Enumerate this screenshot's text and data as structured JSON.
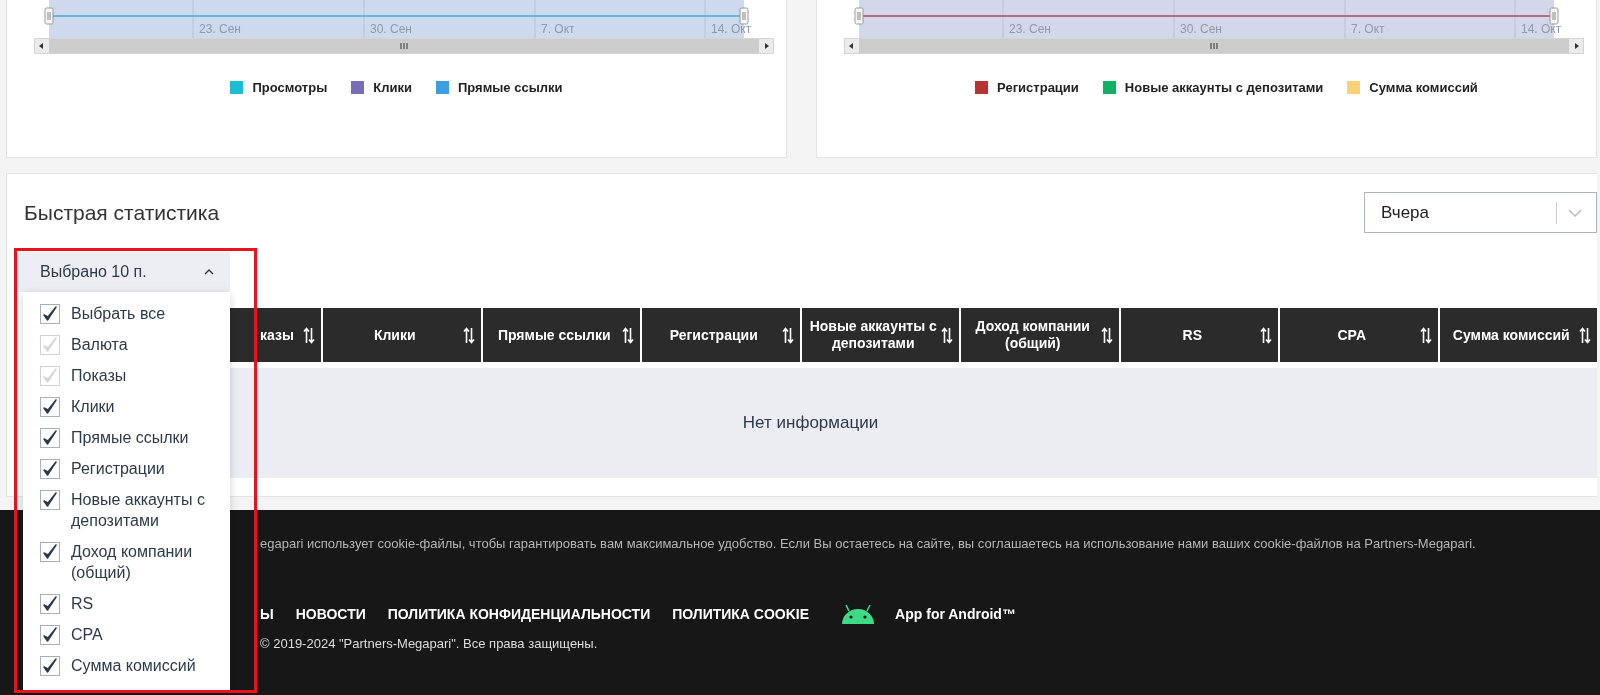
{
  "charts": [
    {
      "axis_labels": [
        "23. Сен",
        "30. Сен",
        "7. Окт",
        "14. Окт"
      ],
      "legend": [
        {
          "label": "Просмотры",
          "color": "#1bbcd4"
        },
        {
          "label": "Клики",
          "color": "#786cb4"
        },
        {
          "label": "Прямые ссылки",
          "color": "#3e9fe0"
        }
      ]
    },
    {
      "axis_labels": [
        "23. Сен",
        "30. Сен",
        "7. Окт",
        "14. Окт"
      ],
      "legend": [
        {
          "label": "Регистрации",
          "color": "#b83234"
        },
        {
          "label": "Новые аккаунты с депозитами",
          "color": "#12b062"
        },
        {
          "label": "Сумма комиссий",
          "color": "#fbd077"
        }
      ]
    }
  ],
  "quick_stats": {
    "title": "Быстрая статистика",
    "period_select": {
      "value": "Вчера"
    },
    "column_picker": {
      "label": "Выбрано 10 п.",
      "expanded": true,
      "options": [
        {
          "label": "Выбрать все",
          "checked": true,
          "disabled": false
        },
        {
          "label": "Валюта",
          "checked": true,
          "disabled": true
        },
        {
          "label": "Показы",
          "checked": true,
          "disabled": true
        },
        {
          "label": "Клики",
          "checked": true,
          "disabled": false
        },
        {
          "label": "Прямые ссылки",
          "checked": true,
          "disabled": false
        },
        {
          "label": "Регистрации",
          "checked": true,
          "disabled": false
        },
        {
          "label": "Новые аккаунты с депозитами",
          "checked": true,
          "disabled": false
        },
        {
          "label": "Доход компании (общий)",
          "checked": true,
          "disabled": false
        },
        {
          "label": "RS",
          "checked": true,
          "disabled": false
        },
        {
          "label": "CPA",
          "checked": true,
          "disabled": false
        },
        {
          "label": "Сумма комиссий",
          "checked": true,
          "disabled": false
        }
      ]
    },
    "table": {
      "columns": [
        "казы",
        "Клики",
        "Прямые ссылки",
        "Регистрации",
        "Новые аккаунты с депозитами",
        "Доход компании (общий)",
        "RS",
        "CPA",
        "Сумма комиссий"
      ],
      "empty_message": "Нет информации"
    }
  },
  "footer": {
    "cookie_notice": "egapari использует cookie-файлы, чтобы гарантировать вам максимальное удобство. Если Вы остаетесь на сайте, вы соглашаетесь на использование нами ваших cookie-файлов на Partners-Megapari.",
    "links": [
      "Ы",
      "НОВОСТИ",
      "ПОЛИТИКА КОНФИДЕНЦИАЛЬНОСТИ",
      "ПОЛИТИКА COOKIE"
    ],
    "app_link": "App for Android™",
    "copyright": "© 2019-2024 \"Partners-Megapari\". Все права защищены."
  }
}
